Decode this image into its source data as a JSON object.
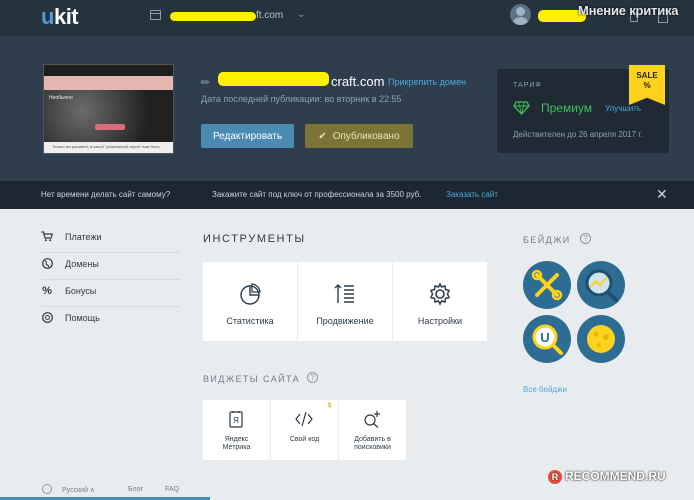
{
  "topbar": {
    "logo_u": "u",
    "logo_rest": "kit",
    "site_domain_suffix": "ft.com",
    "watermark": "Мнение критика",
    "chevron": "⌄"
  },
  "site": {
    "url_suffix": "craft.com",
    "attach_domain": "Прикрепить домен",
    "publish_date": "Дата последней публикации: во вторник в 22:55",
    "edit_button": "Редактировать",
    "published_button": "Опубликовано",
    "published_check": "✔",
    "thumb_title": "Необычно",
    "thumb_bottom": "Только вы решаете, в какой \"уникальной серии\" вам быть"
  },
  "plan": {
    "label": "ТАРИФ",
    "name": "Премиум",
    "upgrade": "Улучшить",
    "valid_until": "Действителен до 26 апреля 2017 г.",
    "sale_line1": "SALE",
    "sale_line2": "%"
  },
  "promo": {
    "left_text": "Нет времени делать сайт самому?",
    "mid_text": "Закажите сайт под ключ от профессионала за 3500 руб.",
    "link": "Заказать сайт",
    "close": "✕"
  },
  "sidebar": {
    "items": [
      {
        "label": "Платежи",
        "icon": "cart-icon",
        "glyph": "🛒"
      },
      {
        "label": "Домены",
        "icon": "globe-icon",
        "glyph": "◍"
      },
      {
        "label": "Бонусы",
        "icon": "percent-icon",
        "glyph": "%"
      },
      {
        "label": "Помощь",
        "icon": "help-globe-icon",
        "glyph": "◎"
      }
    ]
  },
  "tools": {
    "title": "ИНСТРУМЕНТЫ",
    "items": [
      {
        "label": "Статистика",
        "icon": "pie-chart-icon"
      },
      {
        "label": "Продвижение",
        "icon": "sort-lines-icon"
      },
      {
        "label": "Настройки",
        "icon": "gear-icon"
      }
    ]
  },
  "widgets": {
    "title": "ВИДЖЕТЫ САЙТА",
    "help": "?",
    "items": [
      {
        "line1": "Яндекс",
        "line2": "Метрика",
        "icon": "yandex-metrika-icon",
        "letter": "Я"
      },
      {
        "line1": "Свой код",
        "line2": "",
        "icon": "code-icon",
        "dollar": "$"
      },
      {
        "line1": "Добавить в",
        "line2": "поисковики",
        "icon": "search-plus-icon"
      }
    ]
  },
  "badges": {
    "title": "БЕЙДЖИ",
    "help": "?",
    "all_link": "Все бейджи",
    "items": [
      {
        "icon": "tools-badge-icon",
        "color": "#2e6d93"
      },
      {
        "icon": "chart-magnifier-badge-icon",
        "color": "#2e6d93"
      },
      {
        "icon": "ukit-magnifier-badge-icon",
        "color": "#2e6d93"
      },
      {
        "icon": "moon-badge-icon",
        "color": "#2e6d93"
      }
    ]
  },
  "footer": {
    "language": "Русский ∧",
    "blog": "Блог",
    "faq": "FAQ",
    "watermark": "RECOMMEND.RU",
    "watermark_mark": "R"
  },
  "colors": {
    "accent_blue": "#4a8ab3",
    "link_blue": "#4ca7e0",
    "premium_green": "#3fbf5a",
    "sale_yellow": "#ffd21e",
    "dark_bg": "#2f3e4c"
  }
}
